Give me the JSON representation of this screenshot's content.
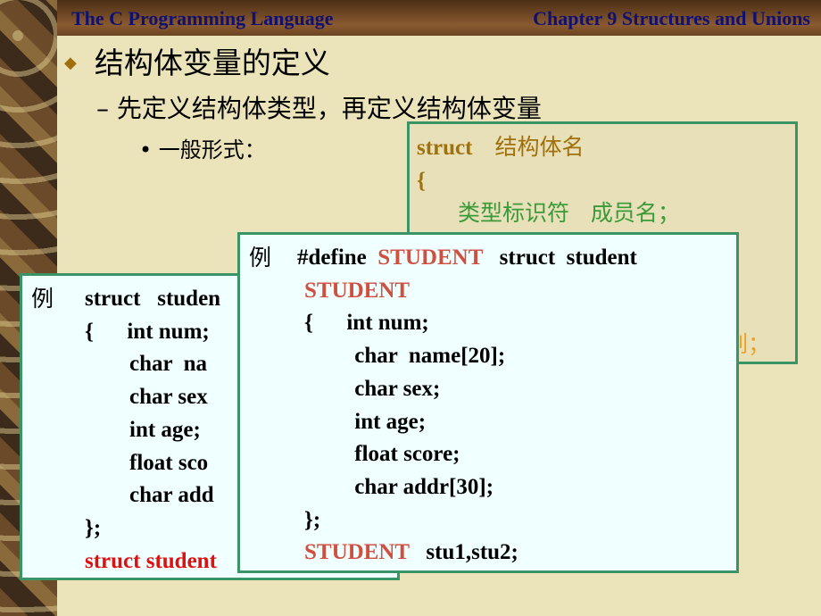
{
  "header": {
    "left_title": "The C Programming Language",
    "right_title": "Chapter 9 Structures  and Unions"
  },
  "content": {
    "bullet1": "结构体变量的定义",
    "bullet2": "先定义结构体类型，再定义结构体变量",
    "bullet3": "一般形式："
  },
  "general_form": {
    "line1_kw": "struct",
    "line1_name": "结构体名",
    "line2": "{",
    "line3": "类型标识符   成员名；",
    "line_last": "列；"
  },
  "example_left": {
    "label": "例",
    "lines": [
      "struct   studen",
      "{      int num;",
      "        char  na",
      "        char sex",
      "        int age;",
      "        float sco",
      "        char add",
      "};"
    ],
    "last": "struct student"
  },
  "example_front": {
    "label": "例",
    "define": "#define",
    "macro": "STUDENT",
    "define_rest": "struct  student",
    "lines": [
      "{      int num;",
      "         char  name[20];",
      "         char sex;",
      "         int age;",
      "         float score;",
      "         char addr[30];",
      "};"
    ],
    "decl_type": "STUDENT",
    "decl_vars": "stu1,stu2;"
  },
  "colors": {
    "border": "#3b9466",
    "macro": "#d05040",
    "header_text": "#101070"
  }
}
